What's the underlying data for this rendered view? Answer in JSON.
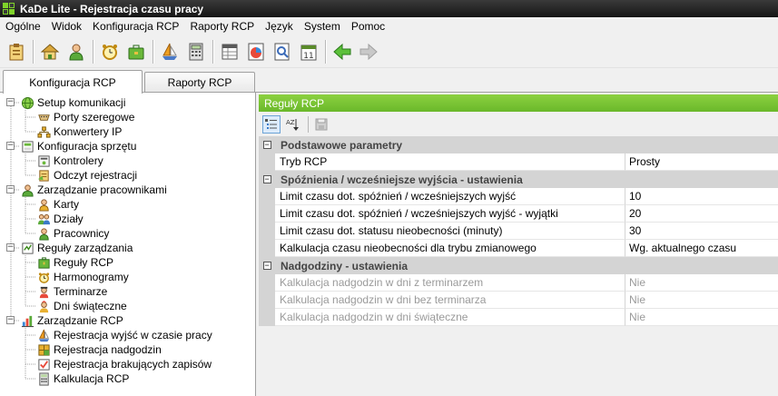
{
  "window": {
    "title": "KaDe Lite - Rejestracja czasu pracy"
  },
  "menu": [
    "Ogólne",
    "Widok",
    "Konfiguracja RCP",
    "Raporty RCP",
    "Język",
    "System",
    "Pomoc"
  ],
  "toolbar": {
    "buttons": [
      "clipboard-icon",
      "house-icon",
      "person-icon",
      "alarm-clock-icon",
      "briefcase-icon",
      "sailboat-icon",
      "calculator-icon",
      "spreadsheet-icon",
      "chart-report-icon",
      "search-report-icon",
      "calendar-icon",
      "back-arrow-icon",
      "forward-arrow-icon"
    ],
    "calendar_day": "11"
  },
  "tabs": {
    "active": "Konfiguracja RCP",
    "other": "Raporty RCP"
  },
  "tree": [
    {
      "label": "Setup komunikacji",
      "icon": "globe-icon",
      "level": 0
    },
    {
      "label": "Porty szeregowe",
      "icon": "serial-port-icon",
      "level": 1
    },
    {
      "label": "Konwertery IP",
      "icon": "network-icon",
      "level": 1
    },
    {
      "label": "Konfiguracja sprzętu",
      "icon": "hardware-icon",
      "level": 0
    },
    {
      "label": "Kontrolery",
      "icon": "controller-icon",
      "level": 1
    },
    {
      "label": "Odczyt rejestracji",
      "icon": "read-log-icon",
      "level": 1
    },
    {
      "label": "Zarządzanie pracownikami",
      "icon": "people-icon",
      "level": 0
    },
    {
      "label": "Karty",
      "icon": "card-icon",
      "level": 1
    },
    {
      "label": "Działy",
      "icon": "department-icon",
      "level": 1
    },
    {
      "label": "Pracownicy",
      "icon": "worker-icon",
      "level": 1
    },
    {
      "label": "Reguły zarządzania",
      "icon": "rules-icon",
      "level": 0
    },
    {
      "label": "Reguły RCP",
      "icon": "rcp-rules-icon",
      "level": 1
    },
    {
      "label": "Harmonogramy",
      "icon": "schedule-icon",
      "level": 1
    },
    {
      "label": "Terminarze",
      "icon": "scheduler-icon",
      "level": 1
    },
    {
      "label": "Dni świąteczne",
      "icon": "holiday-icon",
      "level": 1
    },
    {
      "label": "Zarządzanie RCP",
      "icon": "bar-chart-icon",
      "level": 0
    },
    {
      "label": "Rejestracja wyjść w czasie pracy",
      "icon": "sailboat-icon",
      "level": 1
    },
    {
      "label": "Rejestracja nadgodzin",
      "icon": "grid-icon",
      "level": 1
    },
    {
      "label": "Rejestracja brakujących zapisów",
      "icon": "checklist-icon",
      "level": 1
    },
    {
      "label": "Kalkulacja RCP",
      "icon": "calculator-icon",
      "level": 1
    }
  ],
  "panel": {
    "title": "Reguły RCP",
    "toolbar": [
      "categorized-icon",
      "alphabetical-icon",
      "save-icon"
    ],
    "alpha_label": "AZ"
  },
  "properties": [
    {
      "type": "category",
      "label": "Podstawowe parametry"
    },
    {
      "type": "prop",
      "name": "Tryb RCP",
      "value": "Prosty"
    },
    {
      "type": "category",
      "label": "Spóźnienia / wcześniejsze wyjścia - ustawienia"
    },
    {
      "type": "prop",
      "name": "Limit czasu dot. spóźnień / wcześniejszych wyjść",
      "value": "10"
    },
    {
      "type": "prop",
      "name": "Limit czasu dot. spóźnień / wcześniejszych wyjść - wyjątki",
      "value": "20"
    },
    {
      "type": "prop",
      "name": "Limit czasu dot. statusu nieobecności (minuty)",
      "value": "30"
    },
    {
      "type": "prop",
      "name": "Kalkulacja czasu nieobecności dla trybu zmianowego",
      "value": "Wg. aktualnego czasu"
    },
    {
      "type": "category",
      "label": "Nadgodziny - ustawienia"
    },
    {
      "type": "prop",
      "name": "Kalkulacja nadgodzin w dni z terminarzem",
      "value": "Nie",
      "disabled": true
    },
    {
      "type": "prop",
      "name": "Kalkulacja nadgodzin w dni bez terminarza",
      "value": "Nie",
      "disabled": true
    },
    {
      "type": "prop",
      "name": "Kalkulacja nadgodzin w dni świąteczne",
      "value": "Nie",
      "disabled": true
    }
  ],
  "colors": {
    "header_green": "#7cc536",
    "category_gray": "#d4d4d4"
  }
}
